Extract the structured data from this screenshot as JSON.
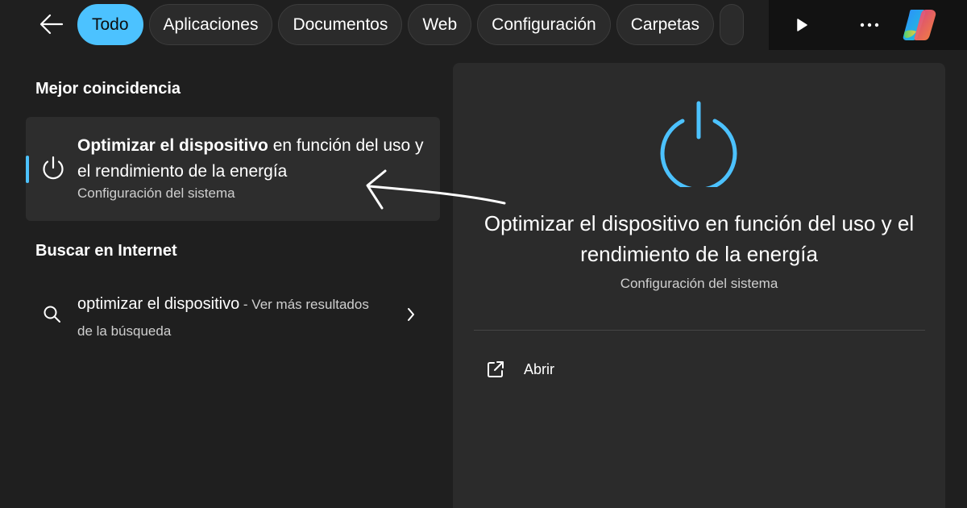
{
  "filters": [
    {
      "label": "Todo",
      "active": true
    },
    {
      "label": "Aplicaciones",
      "active": false
    },
    {
      "label": "Documentos",
      "active": false
    },
    {
      "label": "Web",
      "active": false
    },
    {
      "label": "Configuración",
      "active": false
    },
    {
      "label": "Carpetas",
      "active": false
    }
  ],
  "icons": {
    "back": "arrow-left-icon",
    "play": "play-icon",
    "more": "more-horizontal-icon",
    "copilot": "copilot-logo-icon",
    "power": "power-icon",
    "search": "search-icon",
    "chevron": "chevron-right-icon",
    "open": "open-external-icon"
  },
  "colors": {
    "accent": "#4cc2ff",
    "background": "#1f1f1f",
    "panel": "#2b2b2b"
  },
  "best_match": {
    "section_title": "Mejor coincidencia",
    "title_bold": "Optimizar el dispositivo",
    "title_rest": " en función del uso y el rendimiento de la energía",
    "subtitle": "Configuración del sistema"
  },
  "web_search": {
    "section_title": "Buscar en Internet",
    "query": "optimizar el dispositivo",
    "suffix": " - Ver más resultados de la búsqueda"
  },
  "preview": {
    "title": "Optimizar el dispositivo en función del uso y el rendimiento de la energía",
    "subtitle": "Configuración del sistema",
    "actions": [
      {
        "label": "Abrir"
      }
    ]
  }
}
